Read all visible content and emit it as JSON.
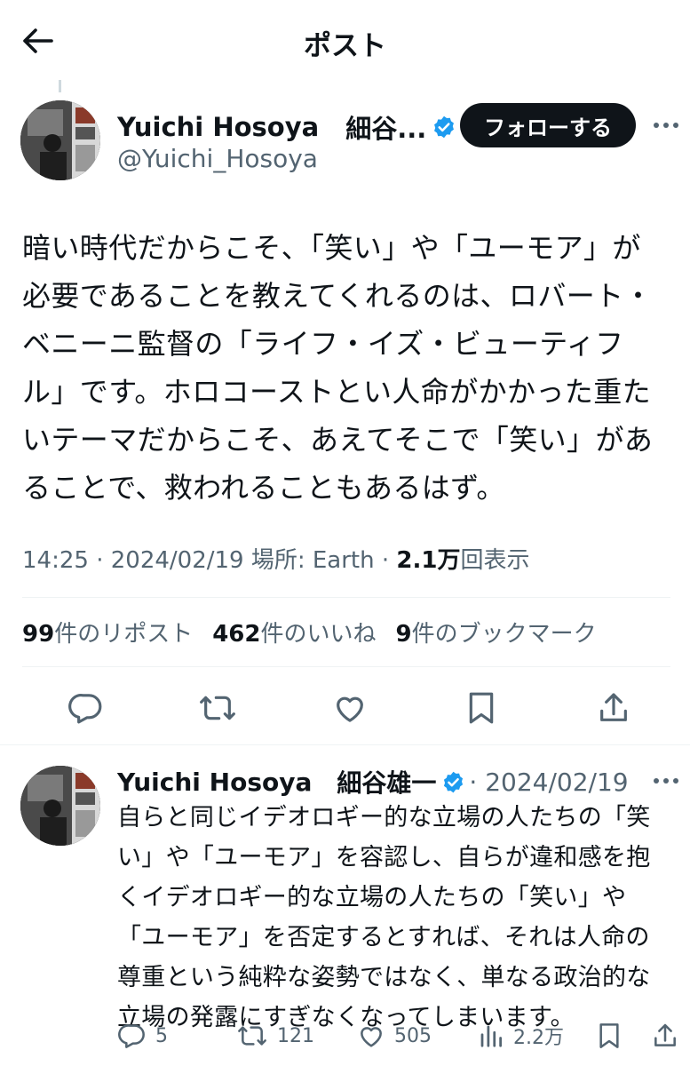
{
  "header": {
    "title": "ポスト",
    "back_icon": "arrow-left-icon"
  },
  "post": {
    "author": {
      "name": "Yuichi Hosoya",
      "name_ja": "細谷...",
      "handle": "@Yuichi_Hosoya",
      "verified": true
    },
    "follow_label": "フォローする",
    "text_lines": [
      "暗い時代だからこそ、「笑い」や「ユーモア」が",
      "必要であることを教えてくれるのは、ロバート・",
      "ベニーニ監督の「ライフ・イズ・ビューティフ",
      "ル」です。ホロコーストとい人命がかかった重た",
      "いテーマだからこそ、あえてそこで「笑い」があ",
      "ることで、救われることもあるはず。"
    ],
    "meta": {
      "time": "14:25",
      "date": "2024/02/19",
      "location_label": "場所: Earth",
      "views": "2.1万",
      "views_label": "回表示"
    },
    "stats": {
      "reposts": "99",
      "reposts_label": "件のリポスト",
      "likes": "462",
      "likes_label": "件のいいね",
      "bookmarks": "9",
      "bookmarks_label": "件のブックマーク"
    },
    "actions": [
      "reply-icon",
      "repost-icon",
      "like-icon",
      "bookmark-icon",
      "share-icon"
    ]
  },
  "reply": {
    "author": {
      "name": "Yuichi Hosoya",
      "name_ja": "細谷雄一",
      "verified": true
    },
    "date": "· 2024/02/19",
    "text_lines": [
      "自らと同じイデオロギー的な立場の人たちの「笑",
      "い」や「ユーモア」を容認し、自らが違和感を抱",
      "くイデオロギー的な立場の人たちの「笑い」や",
      "「ユーモア」を否定するとすれば、それは人命の",
      "尊重という純粋な姿勢ではなく、単なる政治的な",
      "立場の発露にすぎなくなってしまいます。"
    ],
    "counts": {
      "replies": "5",
      "reposts": "121",
      "likes": "505",
      "views": "2.2万"
    }
  },
  "colors": {
    "text": "#0f1419",
    "secondary": "#536471",
    "verified": "#1d9bf0",
    "divider": "#eff3f4"
  }
}
